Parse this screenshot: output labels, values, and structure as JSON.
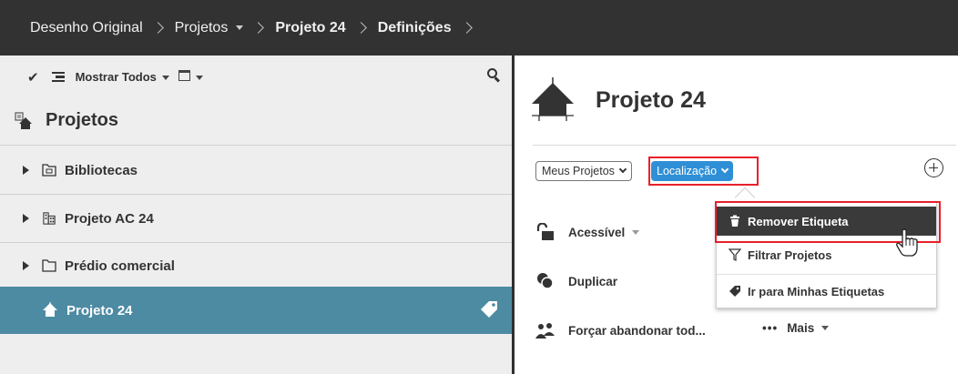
{
  "breadcrumb": {
    "items": [
      "Desenho Original",
      "Projetos",
      "Projeto 24",
      "Definições"
    ]
  },
  "left_panel": {
    "toolbar": {
      "show_all": "Mostrar Todos"
    },
    "title": "Projetos",
    "tree": [
      {
        "label": "Bibliotecas",
        "icon": "library-folder-icon"
      },
      {
        "label": "Projeto AC 24",
        "icon": "building-icon"
      },
      {
        "label": "Prédio comercial",
        "icon": "folder-icon"
      },
      {
        "label": "Projeto 24",
        "icon": "house-icon",
        "selected": true
      }
    ]
  },
  "project": {
    "title": "Projeto 24",
    "filter_select": "Meus Projetos",
    "tag_button": "Localização",
    "actions": {
      "accessible": "Acessível",
      "duplicate": "Duplicar",
      "force_abandon": "Forçar abandonar tod...",
      "more": "Mais"
    }
  },
  "tag_menu": {
    "items": [
      "Remover Etiqueta",
      "Filtrar Projetos",
      "Ir para Minhas Etiquetas"
    ],
    "highlighted_index": 0
  },
  "colors": {
    "topbar": "#323232",
    "selected_row": "#4d8ba3",
    "tag_button": "#2f8fd6",
    "highlight_box": "#e8202a",
    "menu_highlight": "#3a3a3a"
  }
}
